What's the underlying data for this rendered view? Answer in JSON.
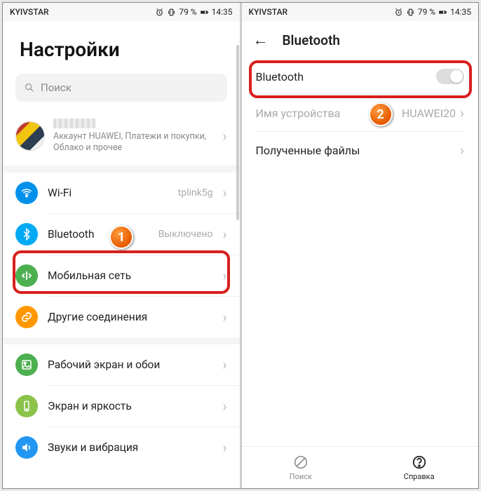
{
  "statusbar": {
    "carrier": "KYIVSTAR",
    "battery": "79 %",
    "time": "14:35"
  },
  "left": {
    "title": "Настройки",
    "search_placeholder": "Поиск",
    "account_sub": "Аккаунт HUAWEI, Платежи и покупки, Облако и прочее",
    "wifi": {
      "label": "Wi-Fi",
      "value": "tplink5g"
    },
    "bluetooth": {
      "label": "Bluetooth",
      "value": "Выключено"
    },
    "mobile": {
      "label": "Мобильная сеть"
    },
    "other": {
      "label": "Другие соединения"
    },
    "wallpaper": {
      "label": "Рабочий экран и обои"
    },
    "display": {
      "label": "Экран и яркость"
    },
    "sound": {
      "label": "Звуки и вибрация"
    }
  },
  "right": {
    "header": "Bluetooth",
    "toggle_label": "Bluetooth",
    "device_name_label": "Имя устройства",
    "device_name_value": "HUAWEI20",
    "received_files": "Полученные файлы",
    "bottom_search": "Поиск",
    "bottom_help": "Справка"
  },
  "badges": {
    "one": "1",
    "two": "2"
  }
}
